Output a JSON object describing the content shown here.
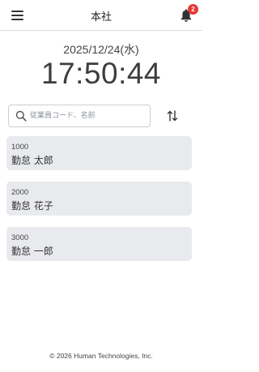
{
  "header": {
    "title": "本社",
    "notification_count": "2",
    "menu_icon": "hamburger-menu-icon",
    "bell_icon": "bell-icon"
  },
  "clock": {
    "date": "2025/12/24(水)",
    "time": "17:50:44"
  },
  "search": {
    "placeholder": "従業員コード、名前",
    "value": "",
    "icon": "search-icon",
    "sort_icon": "sort-arrows-icon"
  },
  "employees": [
    {
      "code": "1000",
      "name": "勤怠 太郎"
    },
    {
      "code": "2000",
      "name": "勤怠 花子"
    },
    {
      "code": "3000",
      "name": "勤怠 一郎"
    }
  ],
  "footer": {
    "copyright": "© 2026 Human Technologies, Inc."
  },
  "colors": {
    "badge": "#e53935",
    "card_background": "#e9eaed",
    "text": "#333333"
  }
}
